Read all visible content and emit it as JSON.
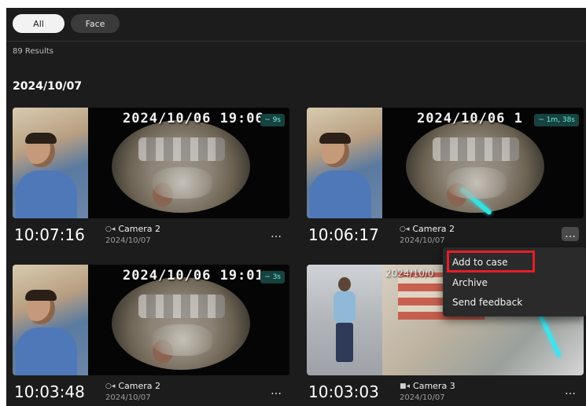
{
  "filters": {
    "all_label": "All",
    "face_label": "Face"
  },
  "results_text": "89 Results",
  "date_heading": "2024/10/07",
  "cards": [
    {
      "stamp": "2024/10/06 19:06",
      "duration": "9s",
      "time": "10:07:16",
      "camera": "Camera 2",
      "date": "2024/10/07",
      "more": "…"
    },
    {
      "stamp": "2024/10/06 1",
      "duration": "1m, 38s",
      "time": "10:06:17",
      "camera": "Camera 2",
      "date": "2024/10/07",
      "more": "…"
    },
    {
      "stamp": "2024/10/06 19:01",
      "duration": "3s",
      "time": "10:03:48",
      "camera": "Camera 2",
      "date": "2024/10/07",
      "more": "…"
    },
    {
      "stamp": "2024/10/0",
      "time": "10:03:03",
      "camera": "Camera 3",
      "date": "2024/10/07",
      "more": "…"
    }
  ],
  "context_menu": {
    "items": [
      "Add to case",
      "Archive",
      "Send feedback"
    ],
    "highlight_color": "#e51e2a"
  },
  "colors": {
    "background": "#1c1c1c",
    "duration_badge": "#17423f",
    "duration_text": "#6ff0df"
  },
  "icons": {
    "camera": "camera-icon",
    "video": "video-icon",
    "more": "more-horizontal-icon",
    "duration": "tilde-icon"
  }
}
